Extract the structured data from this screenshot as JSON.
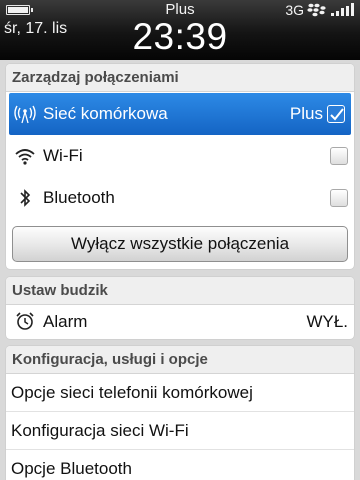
{
  "status_bar": {
    "carrier": "Plus",
    "date": "śr, 17. lis",
    "time": "23:39",
    "network_type": "3G",
    "battery_level": 1.0,
    "signal_bars": 5
  },
  "connections": {
    "header": "Zarządzaj połączeniami",
    "items": [
      {
        "label": "Sieć komórkowa",
        "right_text": "Plus",
        "checked": true,
        "icon": "antenna-icon",
        "selected": true
      },
      {
        "label": "Wi-Fi",
        "right_text": "",
        "checked": false,
        "icon": "wifi-icon",
        "selected": false
      },
      {
        "label": "Bluetooth",
        "right_text": "",
        "checked": false,
        "icon": "bluetooth-icon",
        "selected": false
      }
    ],
    "disable_all_button": "Wyłącz wszystkie połączenia"
  },
  "alarm": {
    "header": "Ustaw budzik",
    "label": "Alarm",
    "value": "WYŁ.",
    "icon": "alarm-clock-icon"
  },
  "config": {
    "header": "Konfiguracja, usługi i opcje",
    "items": [
      "Opcje sieci telefonii komórkowej",
      "Konfiguracja sieci Wi-Fi",
      "Opcje Bluetooth"
    ]
  },
  "colors": {
    "selection": "#1f78d6",
    "header_bg": "#efefef",
    "status_bar": "#111111"
  }
}
